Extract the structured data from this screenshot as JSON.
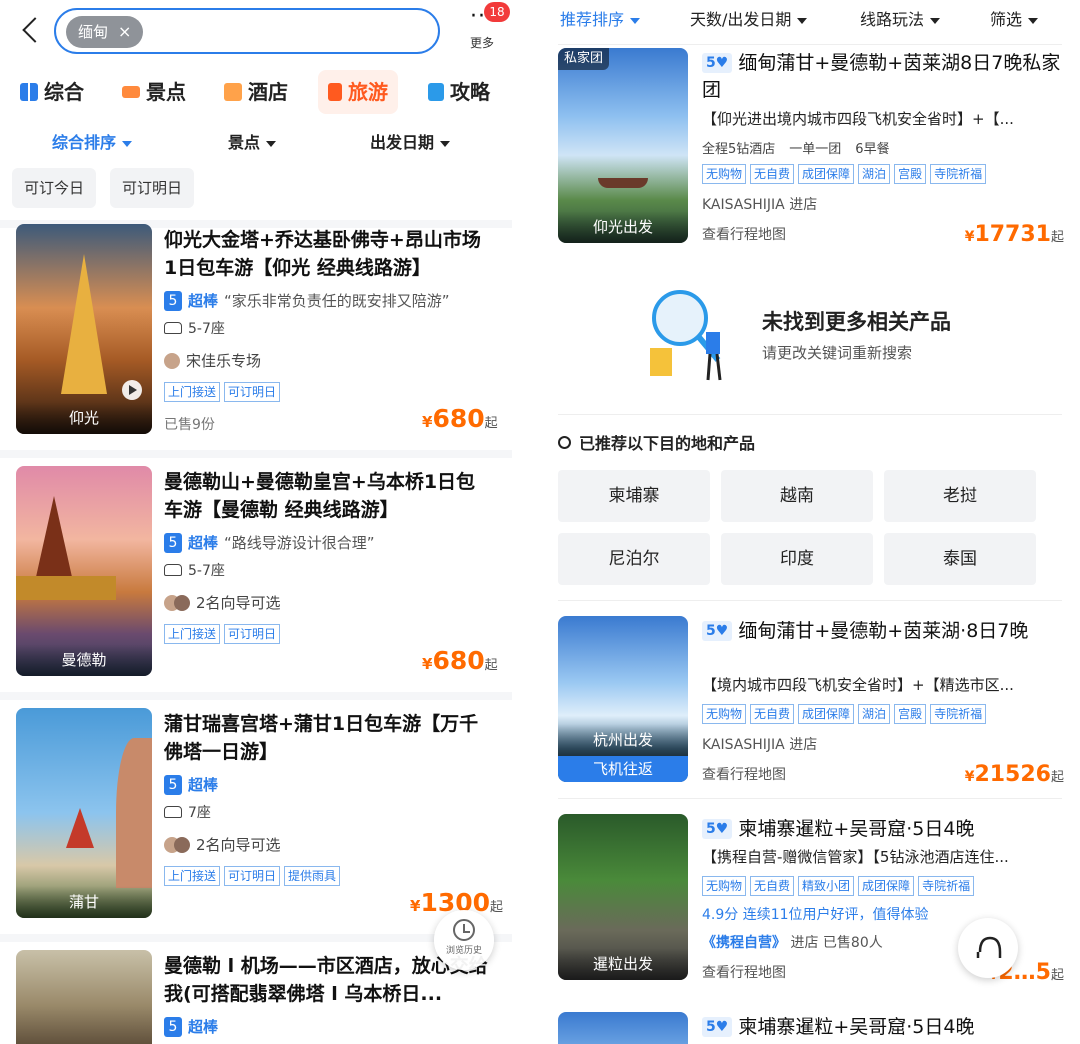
{
  "left": {
    "search": {
      "chip": "缅甸",
      "chip_close": "×"
    },
    "more": {
      "dots": "···",
      "label": "更多",
      "badge": "18"
    },
    "categories": [
      "综合",
      "景点",
      "酒店",
      "旅游",
      "攻略"
    ],
    "sorts": [
      "综合排序",
      "景点",
      "出发日期"
    ],
    "filters": [
      "可订今日",
      "可订明日"
    ],
    "products": [
      {
        "title": "仰光大金塔+乔达基卧佛寺+昂山市场1日包车游【仰光 经典线路游】",
        "rating": "5",
        "rating_text": "超棒",
        "quote": "“家乐非常负责任的既安排又陪游”",
        "seats": "5-7座",
        "guide": "宋佳乐专场",
        "tags": [
          "上门接送",
          "可订明日"
        ],
        "sold": "已售9份",
        "price": "680",
        "currency": "¥",
        "suffix": "起",
        "city": "仰光"
      },
      {
        "title": "曼德勒山+曼德勒皇宫+乌本桥1日包车游【曼德勒 经典线路游】",
        "rating": "5",
        "rating_text": "超棒",
        "quote": "“路线导游设计很合理”",
        "seats": "5-7座",
        "guide": "2名向导可选",
        "tags": [
          "上门接送",
          "可订明日"
        ],
        "price": "680",
        "currency": "¥",
        "suffix": "起",
        "city": "曼德勒"
      },
      {
        "title": "蒲甘瑞喜宫塔+蒲甘1日包车游【万千佛塔一日游】",
        "rating": "5",
        "rating_text": "超棒",
        "seats": "7座",
        "guide": "2名向导可选",
        "tags": [
          "上门接送",
          "可订明日",
          "提供雨具"
        ],
        "price": "1300",
        "currency": "¥",
        "suffix": "起",
        "city": "蒲甘"
      },
      {
        "title": "曼德勒 l 机场——市区酒店，放心交给我(可搭配翡翠佛塔 l 乌本桥日...",
        "rating": "5",
        "rating_text": "超棒"
      }
    ],
    "history_label": "浏览历史"
  },
  "right": {
    "sorts": [
      "推荐排序",
      "天数/出发日期",
      "线路玩法",
      "筛选"
    ],
    "top_product": {
      "badge": "5",
      "title": "缅甸蒲甘+曼德勒+茵莱湖8日7晚私家团",
      "subtitle": "【仰光进出境内城市四段飞机安全省时】+【...",
      "meta": [
        "全程5钻酒店",
        "一单一团",
        "6早餐"
      ],
      "tags": [
        "无购物",
        "无自费",
        "成团保障",
        "湖泊",
        "宫殿",
        "寺院祈福"
      ],
      "shop": "KAISASHIJIA 进店",
      "map": "查看行程地图",
      "price": "17731",
      "currency": "¥",
      "suffix": "起",
      "img_top": "私家团",
      "img_caption": "仰光出发"
    },
    "empty": {
      "title": "未找到更多相关产品",
      "subtitle": "请更改关键词重新搜索"
    },
    "rec_header": "已推荐以下目的地和产品",
    "destinations": [
      "柬埔寨",
      "越南",
      "老挝",
      "尼泊尔",
      "印度",
      "泰国"
    ],
    "products": [
      {
        "badge": "5",
        "title": "缅甸蒲甘+曼德勒+茵莱湖·8日7晚",
        "subtitle": "【境内城市四段飞机安全省时】+【精选市区...",
        "tags": [
          "无购物",
          "无自费",
          "成团保障",
          "湖泊",
          "宫殿",
          "寺院祈福"
        ],
        "shop": "KAISASHIJIA 进店",
        "map": "查看行程地图",
        "price": "21526",
        "currency": "¥",
        "suffix": "起",
        "img_caption": "杭州出发",
        "img_bar": "飞机往返"
      },
      {
        "badge": "5",
        "title": "柬埔寨暹粒+吴哥窟·5日4晚",
        "subtitle": "【携程自营-赠微信管家】【5钻泳池酒店连住...",
        "tags": [
          "无购物",
          "无自费",
          "精致小团",
          "成团保障",
          "寺院祈福"
        ],
        "review": "4.9分  连续11位用户好评，值得体验",
        "shop_brand": "《携程自营》",
        "shop": "进店",
        "sold": "已售80人",
        "map": "查看行程地图",
        "price_partial": "2…5",
        "currency": "¥",
        "suffix": "起",
        "img_caption": "暹粒出发"
      },
      {
        "badge": "5",
        "title": "柬埔寨暹粒+吴哥窟·5日4晚"
      }
    ]
  },
  "colors": {
    "accent_blue": "#2b7de9",
    "price_orange": "#ff6a00",
    "badge_red": "#f23a3a"
  }
}
